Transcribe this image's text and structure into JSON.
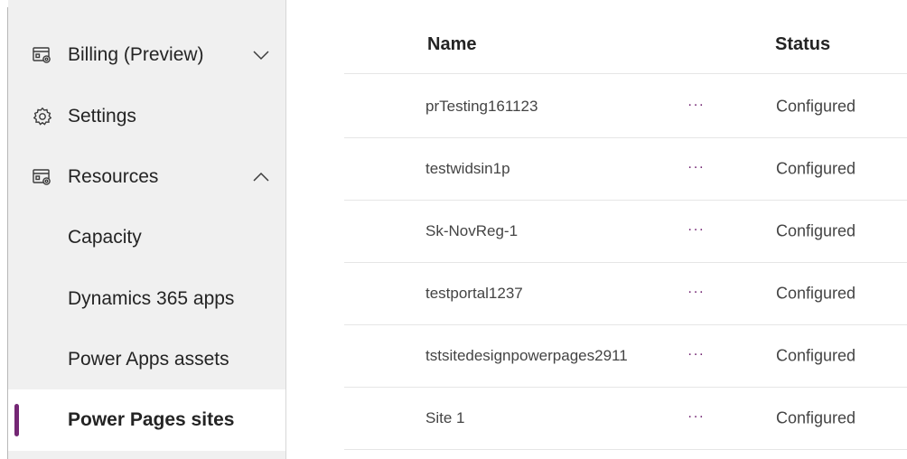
{
  "sidebar": {
    "items": [
      {
        "label": "Billing (Preview)",
        "icon": "billing-settings-icon",
        "chevron": "chevron-down-icon"
      },
      {
        "label": "Settings",
        "icon": "gear-icon"
      },
      {
        "label": "Resources",
        "icon": "resources-settings-icon",
        "chevron": "chevron-up-icon"
      },
      {
        "label": "Capacity"
      },
      {
        "label": "Dynamics 365 apps"
      },
      {
        "label": "Power Apps assets"
      },
      {
        "label": "Power Pages sites",
        "selected": true
      }
    ],
    "accent_color": "#742774"
  },
  "table": {
    "columns": {
      "name": "Name",
      "status": "Status"
    },
    "more_label": "···",
    "rows": [
      {
        "name": "prTesting161123",
        "status": "Configured"
      },
      {
        "name": "testwidsin1p",
        "status": "Configured"
      },
      {
        "name": "Sk-NovReg-1",
        "status": "Configured"
      },
      {
        "name": "testportal1237",
        "status": "Configured"
      },
      {
        "name": "tstsitedesignpowerpages2911",
        "status": "Configured"
      },
      {
        "name": "Site 1",
        "status": "Configured"
      }
    ]
  }
}
